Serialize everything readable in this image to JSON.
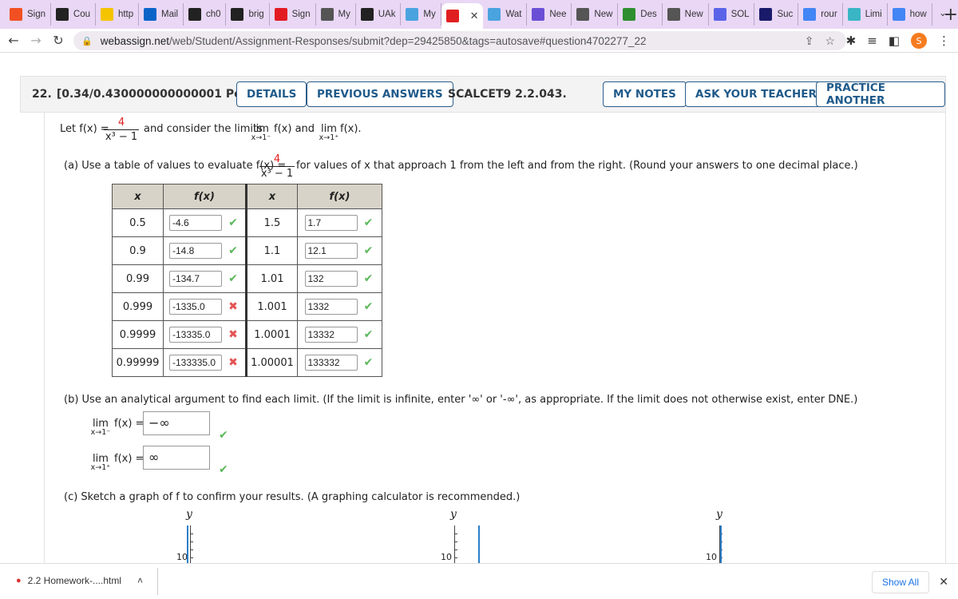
{
  "browser": {
    "tabs": [
      {
        "label": "Sign",
        "icon": "microsoft-icon",
        "color": "#f25022"
      },
      {
        "label": "Cou",
        "icon": "d2l-icon",
        "color": "#222222"
      },
      {
        "label": "http",
        "icon": "yellow-page-icon",
        "color": "#f5c400"
      },
      {
        "label": "Mail",
        "icon": "outlook-icon",
        "color": "#0a64c8"
      },
      {
        "label": "ch0",
        "icon": "d2l-icon",
        "color": "#222222"
      },
      {
        "label": "brig",
        "icon": "d2l-icon",
        "color": "#222222"
      },
      {
        "label": "Sign",
        "icon": "mcgraw-icon",
        "color": "#e21b23"
      },
      {
        "label": "My",
        "icon": "globe-icon",
        "color": "#555555"
      },
      {
        "label": "UAk",
        "icon": "d2l-icon",
        "color": "#222222"
      },
      {
        "label": "My",
        "icon": "dots-icon",
        "color": "#4aa3df"
      },
      {
        "label": "",
        "icon": "webassign-icon",
        "color": "#e02020",
        "active": true
      },
      {
        "label": "Wat",
        "icon": "dots-icon",
        "color": "#4aa3df"
      },
      {
        "label": "Nee",
        "icon": "s-icon",
        "color": "#6a4fd6"
      },
      {
        "label": "New",
        "icon": "chrome-icon",
        "color": "#555555"
      },
      {
        "label": "Des",
        "icon": "desmos-icon",
        "color": "#2f8f2f"
      },
      {
        "label": "New",
        "icon": "chrome-icon",
        "color": "#555555"
      },
      {
        "label": "SOL",
        "icon": "sol-icon",
        "color": "#5a63e8"
      },
      {
        "label": "Suc",
        "icon": "b-icon",
        "color": "#1a1a6a"
      },
      {
        "label": "rour",
        "icon": "google-icon",
        "color": "#4285f4"
      },
      {
        "label": "Limi",
        "icon": "limi-icon",
        "color": "#3ab5c5"
      },
      {
        "label": "how",
        "icon": "google-icon",
        "color": "#4285f4"
      }
    ],
    "new_tab": "+",
    "url_host": "webassign.net",
    "url_path": "/web/Student/Assignment-Responses/submit?dep=29425850&tags=autosave#question4702277_22",
    "avatar_letter": "S"
  },
  "question": {
    "number": "22.",
    "points": "[0.34/0.430000000000001 Points]",
    "buttons": {
      "details": "DETAILS",
      "previous_answers": "PREVIOUS ANSWERS",
      "my_notes": "MY NOTES",
      "ask_teacher": "ASK YOUR TEACHER",
      "practice_another": "PRACTICE ANOTHER"
    },
    "code": "SCALCET9 2.2.043.",
    "intro": {
      "let": "Let f(x) =",
      "numerator": "4",
      "denominator": "x³ − 1",
      "mid": "and consider the limits",
      "lim": "lim",
      "fx": "f(x)",
      "and": "and",
      "sub_left": "x→1⁻",
      "sub_right": "x→1⁺",
      "end": "f(x)."
    },
    "part_a": {
      "prefix": "(a)  Use a table of values to evaluate f(x) =",
      "numerator": "4",
      "denominator": "x³ − 1",
      "suffix": "for values of x that approach 1 from the left and from the right. (Round your answers to one decimal place.)",
      "headers": [
        "x",
        "f(x)",
        "x",
        "f(x)"
      ],
      "rows": [
        {
          "x1": "0.5",
          "f1": "-4.6",
          "ok1": true,
          "x2": "1.5",
          "f2": "1.7",
          "ok2": true
        },
        {
          "x1": "0.9",
          "f1": "-14.8",
          "ok1": true,
          "x2": "1.1",
          "f2": "12.1",
          "ok2": true
        },
        {
          "x1": "0.99",
          "f1": "-134.7",
          "ok1": true,
          "x2": "1.01",
          "f2": "132",
          "ok2": true
        },
        {
          "x1": "0.999",
          "f1": "-1335.0",
          "ok1": false,
          "x2": "1.001",
          "f2": "1332",
          "ok2": true
        },
        {
          "x1": "0.9999",
          "f1": "-13335.0",
          "ok1": false,
          "x2": "1.0001",
          "f2": "13332",
          "ok2": true
        },
        {
          "x1": "0.99999",
          "f1": "-133335.0",
          "ok1": false,
          "x2": "1.00001",
          "f2": "133332",
          "ok2": true
        }
      ],
      "check_glyph": "✔",
      "cross_glyph": "✖"
    },
    "part_b": {
      "prompt": "(b)  Use an analytical argument to find each limit. (If the limit is infinite, enter '∞' or '-∞', as appropriate. If the limit does not otherwise exist, enter DNE.)",
      "limits": [
        {
          "lim": "lim",
          "sub": "x→1⁻",
          "expr": "f(x) =",
          "answer": "−∞",
          "correct": true
        },
        {
          "lim": "lim",
          "sub": "x→1⁺",
          "expr": "f(x) =",
          "answer": "∞",
          "correct": true
        }
      ]
    },
    "part_c": {
      "prompt": "(c)  Sketch a graph of f to confirm your results. (A graphing calculator is recommended.)",
      "graphs": [
        {
          "axis_label": "y",
          "tick_label": "10"
        },
        {
          "axis_label": "y",
          "tick_label": "10"
        },
        {
          "axis_label": "y",
          "tick_label": "10"
        }
      ]
    }
  },
  "downloads": {
    "file": "2.2 Homework-....html",
    "show_all": "Show All",
    "close": "✕"
  }
}
